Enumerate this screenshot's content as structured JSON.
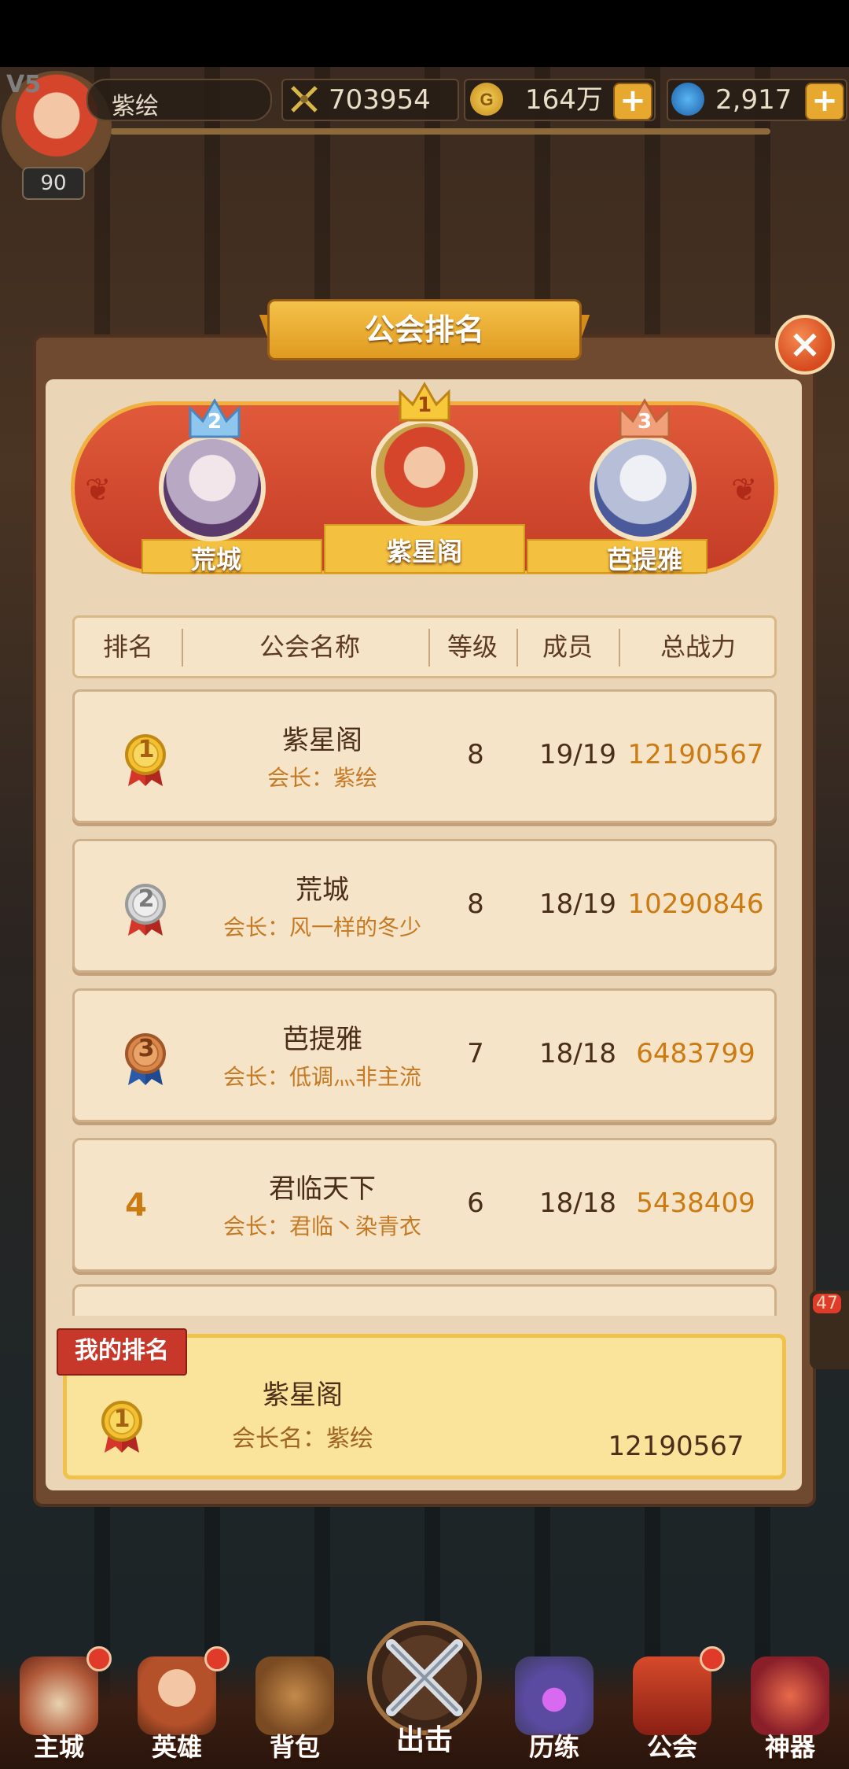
{
  "player": {
    "vip": "V5",
    "level": "90",
    "name": "紫绘",
    "power": "703954",
    "gold": "164万",
    "gems": "2,917"
  },
  "panel": {
    "title": "公会排名",
    "close_label": "×"
  },
  "podium": [
    {
      "rank": "2",
      "name": "荒城"
    },
    {
      "rank": "1",
      "name": "紫星阁"
    },
    {
      "rank": "3",
      "name": "芭提雅"
    }
  ],
  "table": {
    "headers": [
      "排名",
      "公会名称",
      "等级",
      "成员",
      "总战力"
    ],
    "rows": [
      {
        "rank": "1",
        "name": "紫星阁",
        "leader": "会长：紫绘",
        "level": "8",
        "members": "19/19",
        "power": "12190567"
      },
      {
        "rank": "2",
        "name": "荒城",
        "leader": "会长：风一样的冬少",
        "level": "8",
        "members": "18/19",
        "power": "10290846"
      },
      {
        "rank": "3",
        "name": "芭提雅",
        "leader": "会长：低调灬非主流",
        "level": "7",
        "members": "18/18",
        "power": "6483799"
      },
      {
        "rank": "4",
        "name": "君临天下",
        "leader": "会长：君临丶染青衣",
        "level": "6",
        "members": "18/18",
        "power": "5438409"
      }
    ]
  },
  "my_rank": {
    "tag": "我的排名",
    "rank": "1",
    "name": "紫星阁",
    "leader": "会长名：紫绘",
    "power": "12190567"
  },
  "side_badge": "47",
  "nav": [
    {
      "label": "主城",
      "icon": "castle-icon",
      "dot": true
    },
    {
      "label": "英雄",
      "icon": "hero-icon",
      "dot": true
    },
    {
      "label": "背包",
      "icon": "backpack-icon",
      "dot": false
    },
    {
      "label": "出击",
      "icon": "crossed-swords-icon",
      "dot": false
    },
    {
      "label": "历练",
      "icon": "portal-icon",
      "dot": false
    },
    {
      "label": "公会",
      "icon": "guild-banner-icon",
      "dot": true
    },
    {
      "label": "神器",
      "icon": "artifact-icon",
      "dot": false
    }
  ],
  "colors": {
    "accent_gold": "#cc7a12",
    "podium_red": "#c43c26",
    "panel_bg": "#ead5b6",
    "my_rank_bg": "#fae39a"
  }
}
